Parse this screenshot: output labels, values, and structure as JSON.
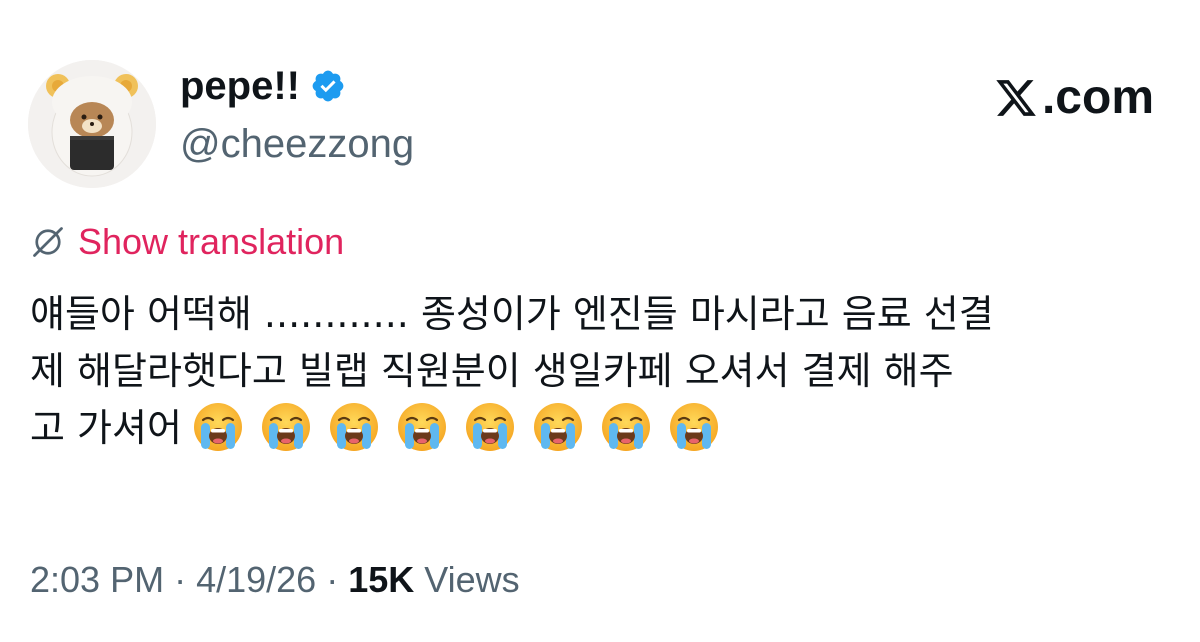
{
  "author": {
    "display_name": "pepe!!",
    "handle": "@cheezzong",
    "verified": true,
    "avatar": "bear-in-rice-ball-hood-avatar"
  },
  "brand": {
    "icon": "x-logo-icon",
    "label": ".com"
  },
  "translation": {
    "icon": "globe-icon",
    "label": "Show translation",
    "color": "#e0245e"
  },
  "tweet": {
    "lines": [
      "얘들아 어떡해 ............ 종성이가 엔진들 마시라고 음료 선결",
      "제 해달라햇다고 빌랩 직원분이 생일카페 오셔서 결제 해주",
      "고 가셔어"
    ],
    "emoji": "loudly-crying-face-icon",
    "emoji_count": 8
  },
  "meta": {
    "time": "2:03 PM",
    "separator": "·",
    "date": "4/19/26",
    "views_count": "15K",
    "views_label": "Views"
  },
  "colors": {
    "text": "#0f1419",
    "secondary": "#536471",
    "verified": "#1d9bf0"
  }
}
